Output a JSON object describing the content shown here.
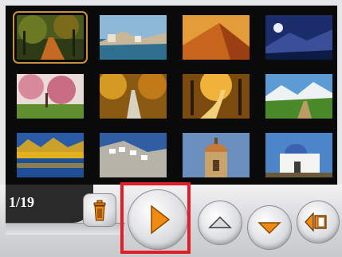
{
  "gallery": {
    "counter_text": "1/19",
    "thumbnails": [
      "autumn-forest-path",
      "coastal-town-cove",
      "desert-sand-dunes",
      "mountain-moon-night",
      "blossom-trees-park",
      "autumn-tree-avenue",
      "golden-woodland-road",
      "alpine-green-valley",
      "yellow-trees-lake",
      "white-cliff-village",
      "domed-chapel",
      "white-church-dome"
    ],
    "selected_index": 0
  },
  "toolbar": {
    "icons": {
      "delete": "trash-icon",
      "play": "play-icon",
      "previous": "arrow-up-icon",
      "next": "arrow-down-icon",
      "back": "back-icon"
    }
  },
  "colors": {
    "accent_orange": "#f08a12",
    "highlight_red": "#e11d26",
    "selection_gold": "#c8923a"
  }
}
